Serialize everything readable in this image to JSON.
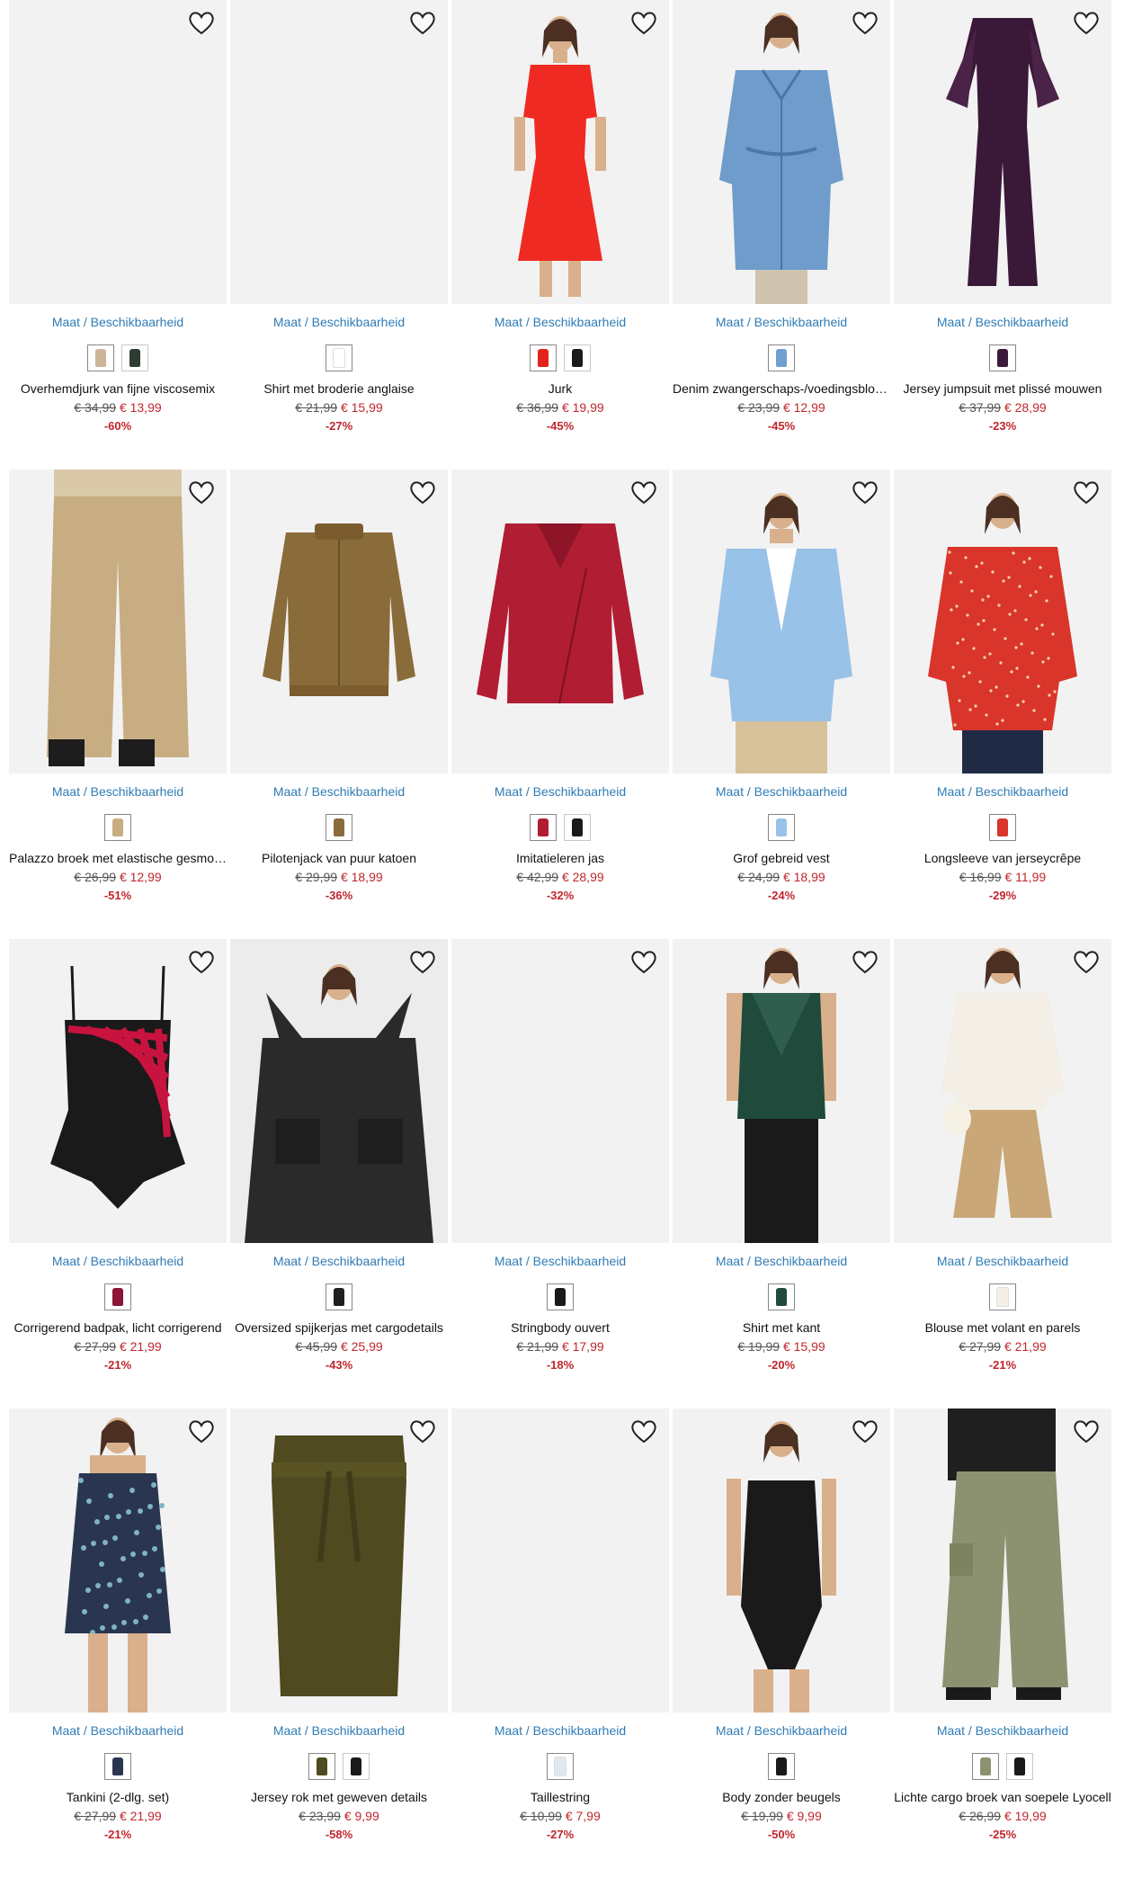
{
  "size_link_label": "Maat / Beschikbaarheid",
  "colors": {
    "link": "#2f7cb5",
    "sale": "#c0262d",
    "image_bg": "#f2f2f2"
  },
  "products": [
    {
      "name": "Overhemdjurk van fijne viscosemix",
      "old_price": "€ 34,99",
      "new_price": "€ 13,99",
      "discount": "-60%",
      "swatches": [
        "#cdb597",
        "#2e3b33"
      ],
      "image": "blank"
    },
    {
      "name": "Shirt met broderie anglaise",
      "old_price": "€ 21,99",
      "new_price": "€ 15,99",
      "discount": "-27%",
      "swatches": [
        "#ffffff"
      ],
      "image": "blank"
    },
    {
      "name": "Jurk",
      "old_price": "€ 36,99",
      "new_price": "€ 19,99",
      "discount": "-45%",
      "swatches": [
        "#e2231a",
        "#1a1a1a"
      ],
      "image": "red-dress"
    },
    {
      "name": "Denim zwangerschaps-/voedingsblouse",
      "old_price": "€ 23,99",
      "new_price": "€ 12,99",
      "discount": "-45%",
      "swatches": [
        "#6f9fcf"
      ],
      "image": "denim-blouse"
    },
    {
      "name": "Jersey jumpsuit met plissé mouwen",
      "old_price": "€ 37,99",
      "new_price": "€ 28,99",
      "discount": "-23%",
      "swatches": [
        "#3c1a3c"
      ],
      "image": "jumpsuit"
    },
    {
      "name": "Palazzo broek met elastische gesmokte band",
      "old_price": "€ 26,99",
      "new_price": "€ 12,99",
      "discount": "-51%",
      "swatches": [
        "#c8ad83"
      ],
      "image": "palazzo"
    },
    {
      "name": "Pilotenjack van puur katoen",
      "old_price": "€ 29,99",
      "new_price": "€ 18,99",
      "discount": "-36%",
      "swatches": [
        "#8a6b3a"
      ],
      "image": "pilot-jacket"
    },
    {
      "name": "Imitatieleren jas",
      "old_price": "€ 42,99",
      "new_price": "€ 28,99",
      "discount": "-32%",
      "swatches": [
        "#b11d33",
        "#1a1a1a"
      ],
      "image": "leather-jacket"
    },
    {
      "name": "Grof gebreid vest",
      "old_price": "€ 24,99",
      "new_price": "€ 18,99",
      "discount": "-24%",
      "swatches": [
        "#99c2e8"
      ],
      "image": "cardigan"
    },
    {
      "name": "Longsleeve van jerseycrêpe",
      "old_price": "€ 16,99",
      "new_price": "€ 11,99",
      "discount": "-29%",
      "swatches": [
        "#d9352b"
      ],
      "image": "red-top"
    },
    {
      "name": "Corrigerend badpak, licht corrigerend",
      "old_price": "€ 27,99",
      "new_price": "€ 21,99",
      "discount": "-21%",
      "swatches": [
        "#8c1535"
      ],
      "image": "swimsuit"
    },
    {
      "name": "Oversized spijkerjas met cargodetails",
      "old_price": "€ 45,99",
      "new_price": "€ 25,99",
      "discount": "-43%",
      "swatches": [
        "#1f1f1f"
      ],
      "image": "black-denim"
    },
    {
      "name": "Stringbody ouvert",
      "old_price": "€ 21,99",
      "new_price": "€ 17,99",
      "discount": "-18%",
      "swatches": [
        "#1a1a1a"
      ],
      "image": "blank"
    },
    {
      "name": "Shirt met kant",
      "old_price": "€ 19,99",
      "new_price": "€ 15,99",
      "discount": "-20%",
      "swatches": [
        "#1f4a3c"
      ],
      "image": "green-lace"
    },
    {
      "name": "Blouse met volant en parels",
      "old_price": "€ 27,99",
      "new_price": "€ 21,99",
      "discount": "-21%",
      "swatches": [
        "#f3efe6"
      ],
      "image": "white-blouse"
    },
    {
      "name": "Tankini (2-dlg. set)",
      "old_price": "€ 27,99",
      "new_price": "€ 21,99",
      "discount": "-21%",
      "swatches": [
        "#2a3550"
      ],
      "image": "tankini"
    },
    {
      "name": "Jersey rok met geweven details",
      "old_price": "€ 23,99",
      "new_price": "€ 9,99",
      "discount": "-58%",
      "swatches": [
        "#4f4a1f",
        "#1a1a1a"
      ],
      "image": "olive-skirt"
    },
    {
      "name": "Taillestring",
      "old_price": "€ 10,99",
      "new_price": "€ 7,99",
      "discount": "-27%",
      "swatches": [
        "#dfe9f2"
      ],
      "image": "blank"
    },
    {
      "name": "Body zonder beugels",
      "old_price": "€ 19,99",
      "new_price": "€ 9,99",
      "discount": "-50%",
      "swatches": [
        "#1a1a1a"
      ],
      "image": "black-body"
    },
    {
      "name": "Lichte cargo broek van soepele Lyocell",
      "old_price": "€ 26,99",
      "new_price": "€ 19,99",
      "discount": "-25%",
      "swatches": [
        "#8c9170",
        "#1a1a1a"
      ],
      "image": "cargo"
    }
  ]
}
